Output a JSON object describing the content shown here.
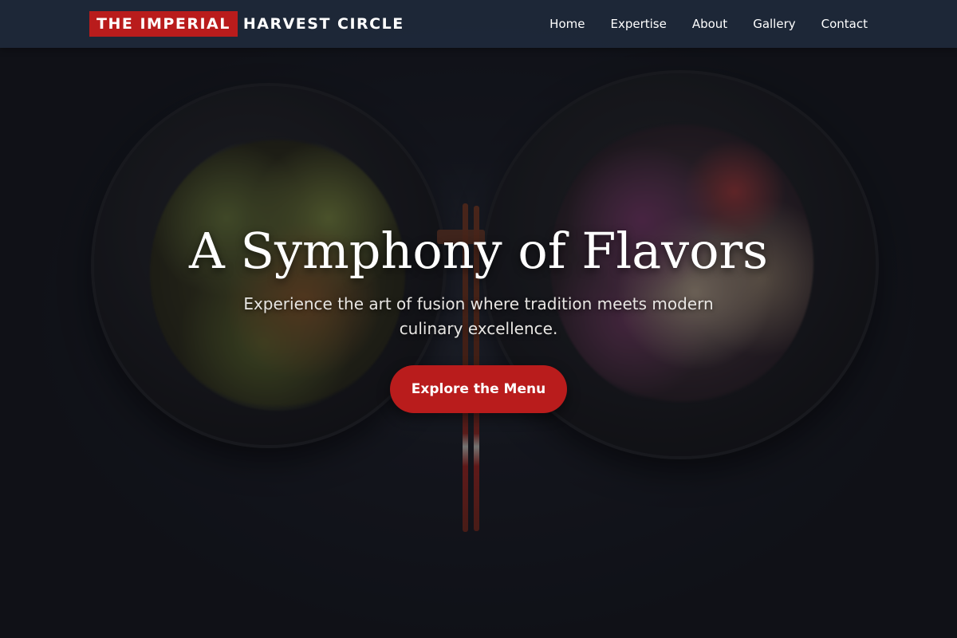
{
  "navbar": {
    "brand_highlight": "THE IMPERIAL",
    "brand_rest": "HARVEST CIRCLE",
    "links": [
      {
        "label": "Home"
      },
      {
        "label": "Expertise"
      },
      {
        "label": "About"
      },
      {
        "label": "Gallery"
      },
      {
        "label": "Contact"
      }
    ]
  },
  "hero": {
    "title": "A Symphony of Flavors",
    "subtitle": "Experience the art of fusion where tradition meets modern culinary excellence.",
    "cta_label": "Explore the Menu",
    "background_image": "dark table with two black bowls of stir-fried shrimp with celery and cabbage slaw, chopsticks between"
  },
  "colors": {
    "accent": "#b91c1c",
    "navbar_bg": "#1e293b",
    "text": "#ffffff"
  }
}
